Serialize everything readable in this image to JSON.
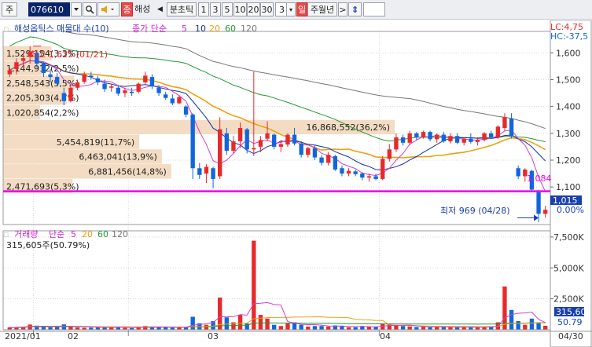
{
  "toolbar": {
    "market_label": "주",
    "code": "076610",
    "name_badge": "종",
    "company": "해성",
    "prev_arrow": "◀",
    "period_label": "분초틱",
    "periods": [
      "1",
      "3",
      "5",
      "10",
      "20",
      "30"
    ],
    "count": "3",
    "day_label": "일",
    "week_month_year": "주월년",
    "next_arrow": ">",
    "updown": "⇕"
  },
  "price_panel": {
    "header_left": "해성옵틱스 매물대 수(10)",
    "header_ma_prefix": "종가 단순",
    "ma_periods": [
      "5",
      "10",
      "20",
      "60",
      "120"
    ],
    "header_right_lc": "LC:4,75",
    "header_right_hc": "HC:-37,5",
    "high_note": "최고 1,625 (01/21)",
    "low_note": "최저 969 (04/28)",
    "last_price": "1,015",
    "last_pct": "0.00%",
    "line_level": "1,084",
    "yticks": [
      "1,600",
      "1,500",
      "1,400",
      "1,300",
      "1,200",
      "1,100"
    ]
  },
  "volume_panel": {
    "header_title": "거래량",
    "header_ma_prefix": "단순",
    "ma_periods": [
      "5",
      "20",
      "60",
      "120"
    ],
    "current": "315,605주(50.79%)",
    "last_volume": "315,60",
    "last_pct": "50.79",
    "yticks": [
      "7,500K",
      "5,000K",
      "2,500K"
    ]
  },
  "xaxis": {
    "labels": [
      "2021/01",
      "02",
      "03",
      "04"
    ],
    "end_label": "04/30"
  },
  "colors": {
    "up": "#e8292b",
    "down": "#1166dd",
    "ma5": "#d040d0",
    "ma10": "#1133aa",
    "ma20": "#f0a010",
    "ma60": "#229933",
    "ma120": "#777777",
    "level": "#ee00ee",
    "profile": "#f3dcc3"
  },
  "chart_data": {
    "type": "candlestick",
    "price_ylim": [
      960,
      1680
    ],
    "volume_ylim_k": [
      0,
      8000
    ],
    "volume_profile": [
      {
        "label": "1,529,154(3,3%)",
        "volume": 1529154,
        "pct": 3.3
      },
      {
        "label": "1,144,912(2,5%)",
        "volume": 1144912,
        "pct": 2.5
      },
      {
        "label": "2,548,543(5,5%)",
        "volume": 2548543,
        "pct": 5.5
      },
      {
        "label": "2,205,303(4,7%)",
        "volume": 2205303,
        "pct": 4.7
      },
      {
        "label": "1,020,854(2,2%)",
        "volume": 1020854,
        "pct": 2.2
      },
      {
        "label": "16,868,552(36,2%)",
        "volume": 16868552,
        "pct": 36.2
      },
      {
        "label": "5,454,819(11,7%)",
        "volume": 5454819,
        "pct": 11.7
      },
      {
        "label": "6,463,041(13,9%)",
        "volume": 6463041,
        "pct": 13.9
      },
      {
        "label": "6,881,456(14,8%)",
        "volume": 6881456,
        "pct": 14.8
      },
      {
        "label": "2,471,693(5,3%)",
        "volume": 2471693,
        "pct": 5.3
      }
    ],
    "candles": [
      [
        1520,
        1545,
        1510,
        1535,
        190
      ],
      [
        1540,
        1580,
        1520,
        1565,
        210
      ],
      [
        1570,
        1600,
        1550,
        1580,
        240
      ],
      [
        1585,
        1625,
        1560,
        1605,
        420
      ],
      [
        1600,
        1610,
        1545,
        1560,
        330
      ],
      [
        1560,
        1565,
        1510,
        1525,
        230
      ],
      [
        1520,
        1540,
        1490,
        1510,
        200
      ],
      [
        1510,
        1525,
        1475,
        1485,
        260
      ],
      [
        1450,
        1470,
        1405,
        1420,
        430
      ],
      [
        1420,
        1480,
        1415,
        1470,
        260
      ],
      [
        1470,
        1500,
        1460,
        1490,
        180
      ],
      [
        1492,
        1530,
        1485,
        1520,
        160
      ],
      [
        1515,
        1530,
        1500,
        1510,
        170
      ],
      [
        1505,
        1515,
        1480,
        1490,
        200
      ],
      [
        1485,
        1500,
        1455,
        1465,
        230
      ],
      [
        1470,
        1485,
        1455,
        1475,
        180
      ],
      [
        1470,
        1480,
        1440,
        1448,
        210
      ],
      [
        1450,
        1470,
        1435,
        1460,
        160
      ],
      [
        1455,
        1470,
        1440,
        1450,
        140
      ],
      [
        1455,
        1490,
        1448,
        1485,
        220
      ],
      [
        1490,
        1530,
        1480,
        1515,
        300
      ],
      [
        1510,
        1520,
        1465,
        1475,
        200
      ],
      [
        1470,
        1480,
        1440,
        1450,
        220
      ],
      [
        1445,
        1455,
        1425,
        1432,
        190
      ],
      [
        1430,
        1445,
        1405,
        1412,
        170
      ],
      [
        1412,
        1440,
        1408,
        1435,
        180
      ],
      [
        1400,
        1405,
        1360,
        1370,
        220
      ],
      [
        1370,
        1375,
        1130,
        1170,
        1050
      ],
      [
        1170,
        1190,
        1130,
        1145,
        520
      ],
      [
        1150,
        1185,
        1115,
        1175,
        400
      ],
      [
        1170,
        1175,
        1095,
        1130,
        700
      ],
      [
        1140,
        1360,
        1130,
        1315,
        2600
      ],
      [
        1300,
        1320,
        1220,
        1235,
        1000
      ],
      [
        1235,
        1290,
        1225,
        1270,
        600
      ],
      [
        1270,
        1340,
        1245,
        1320,
        1200
      ],
      [
        1315,
        1320,
        1225,
        1240,
        500
      ],
      [
        1240,
        1530,
        1215,
        1245,
        7200
      ],
      [
        1250,
        1290,
        1230,
        1275,
        1200
      ],
      [
        1280,
        1345,
        1270,
        1300,
        900
      ],
      [
        1295,
        1300,
        1240,
        1250,
        400
      ],
      [
        1250,
        1275,
        1230,
        1260,
        300
      ],
      [
        1258,
        1300,
        1250,
        1295,
        500
      ],
      [
        1295,
        1320,
        1255,
        1262,
        600
      ],
      [
        1262,
        1270,
        1210,
        1220,
        400
      ],
      [
        1220,
        1250,
        1210,
        1245,
        250
      ],
      [
        1245,
        1255,
        1200,
        1210,
        300
      ],
      [
        1210,
        1220,
        1180,
        1190,
        300
      ],
      [
        1190,
        1230,
        1180,
        1220,
        250
      ],
      [
        1215,
        1220,
        1160,
        1165,
        350
      ],
      [
        1170,
        1180,
        1140,
        1150,
        280
      ],
      [
        1150,
        1170,
        1140,
        1160,
        200
      ],
      [
        1158,
        1165,
        1140,
        1148,
        200
      ],
      [
        1150,
        1155,
        1125,
        1135,
        300
      ],
      [
        1135,
        1150,
        1120,
        1140,
        250
      ],
      [
        1140,
        1150,
        1125,
        1130,
        220
      ],
      [
        1130,
        1215,
        1125,
        1205,
        500
      ],
      [
        1205,
        1260,
        1195,
        1240,
        450
      ],
      [
        1240,
        1300,
        1230,
        1285,
        350
      ],
      [
        1285,
        1295,
        1255,
        1265,
        300
      ],
      [
        1265,
        1310,
        1258,
        1300,
        260
      ],
      [
        1300,
        1305,
        1275,
        1285,
        220
      ],
      [
        1285,
        1310,
        1280,
        1305,
        240
      ],
      [
        1305,
        1310,
        1270,
        1278,
        200
      ],
      [
        1278,
        1300,
        1265,
        1295,
        210
      ],
      [
        1295,
        1305,
        1265,
        1270,
        230
      ],
      [
        1270,
        1300,
        1262,
        1290,
        190
      ],
      [
        1290,
        1300,
        1260,
        1265,
        200
      ],
      [
        1265,
        1285,
        1255,
        1280,
        210
      ],
      [
        1280,
        1300,
        1262,
        1268,
        220
      ],
      [
        1268,
        1285,
        1255,
        1275,
        180
      ],
      [
        1275,
        1305,
        1270,
        1300,
        200
      ],
      [
        1300,
        1310,
        1280,
        1285,
        260
      ],
      [
        1285,
        1330,
        1280,
        1325,
        600
      ],
      [
        1320,
        1375,
        1310,
        1360,
        3500
      ],
      [
        1355,
        1375,
        1280,
        1290,
        1600
      ],
      [
        1170,
        1180,
        1130,
        1140,
        700
      ],
      [
        1140,
        1170,
        1120,
        1165,
        400
      ],
      [
        1160,
        1165,
        1080,
        1090,
        900
      ],
      [
        1080,
        1090,
        969,
        1000,
        600
      ],
      [
        1000,
        1030,
        985,
        1015,
        320
      ]
    ]
  }
}
